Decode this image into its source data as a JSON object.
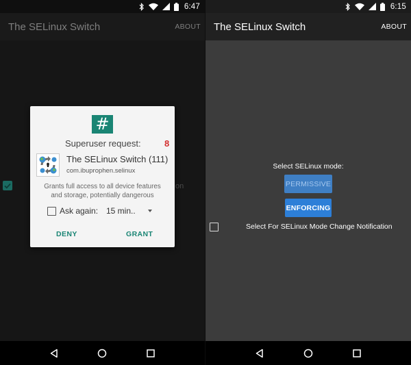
{
  "left": {
    "status": {
      "time": "6:47"
    },
    "appbar": {
      "title": "The SELinux Switch",
      "action": "ABOUT"
    },
    "background": {
      "partial_text": "on"
    },
    "dialog": {
      "hash_symbol": "#",
      "request_label": "Superuser request:",
      "request_count": "8",
      "app_name": "The SELinux Switch (111)",
      "package": "com.ibuprophen.selinux",
      "description_line1": "Grants full access to all device features",
      "description_line2": "and storage, potentially dangerous",
      "ask_again_label": "Ask again:",
      "duration": "15 min..",
      "deny_label": "DENY",
      "grant_label": "GRANT"
    }
  },
  "right": {
    "status": {
      "time": "6:15"
    },
    "appbar": {
      "title": "The SELinux Switch",
      "action": "ABOUT"
    },
    "mode_label": "Select SELinux mode:",
    "permissive_label": "PERMISSIVE",
    "enforcing_label": "ENFORCING",
    "notification_label": "Select For SELinux Mode Change Notification"
  },
  "colors": {
    "accent_teal": "#1a8574",
    "count_red": "#d32f2f",
    "button_blue": "#2d7fd8"
  },
  "icons": [
    "bluetooth-icon",
    "wifi-icon",
    "signal-icon",
    "battery-icon",
    "back-icon",
    "home-icon",
    "recents-icon",
    "dropdown-arrow-icon",
    "checkmark-icon"
  ]
}
